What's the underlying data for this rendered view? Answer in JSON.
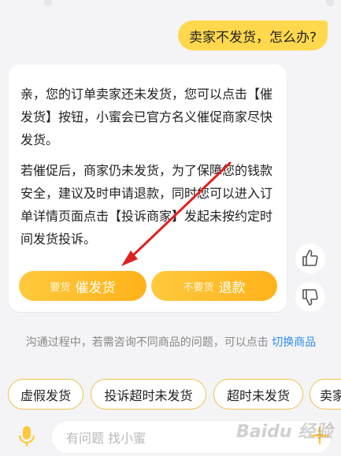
{
  "user_message": "卖家不发货，怎么办?",
  "bot_reply": {
    "paragraph_1": "亲，您的订单卖家还未发货，您可以点击【催发货】按钮，小蜜会已官方名义催促商家尽快发货。",
    "paragraph_2": "若催促后，商家仍未发货，为了保障您的钱款安全，建议及时申请退款，同时您可以进入订单详情页面点击【投诉商家】发起未按约定时间发货投诉。",
    "button_left_small": "要货",
    "button_left_label": "催发货",
    "button_right_small": "不要货",
    "button_right_label": "退款"
  },
  "feedback": {
    "like_icon": "thumbs-up-icon",
    "dislike_icon": "thumbs-down-icon"
  },
  "hint": {
    "text": "沟通过程中，若需咨询不同商品的问题，可以点击 ",
    "link": "切换商品"
  },
  "suggestion_chips": [
    "虚假发货",
    "投诉超时未发货",
    "超时未发货",
    "卖家"
  ],
  "input": {
    "placeholder": "有问题 找小蜜"
  },
  "watermark": "Baidu 经验",
  "colors": {
    "accent": "#ffc93d",
    "annotation_arrow": "#e02020",
    "link": "#2e8ee8"
  }
}
